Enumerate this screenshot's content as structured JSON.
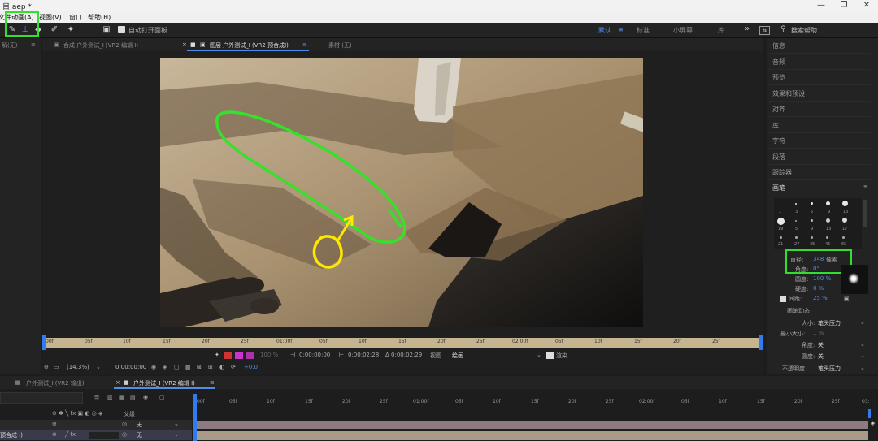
{
  "titlebar": {
    "title": "目.aep *",
    "minimize": "—",
    "maximize": "❐",
    "close": "✕"
  },
  "menubar": {
    "items": [
      "文件",
      "动画(A)",
      "视图(V)",
      "窗口",
      "帮助(H)"
    ]
  },
  "toolbar": {
    "auto_open_label": "自动打开面板",
    "workspaces": [
      "默认",
      "标准",
      "小屏幕",
      "库"
    ],
    "search_placeholder": "搜索帮助",
    "more": "»"
  },
  "left_panel": {
    "header": "解(无)"
  },
  "viewer": {
    "tabs": [
      "合成 户外测试_I (VR2 编辑 I)",
      "图层 户外测试_I (VR2 预合成I)",
      "素材 (无)"
    ],
    "ruler_ticks": [
      "00f",
      "05f",
      "10f",
      "15f",
      "20f",
      "25f",
      "01:00f",
      "05f",
      "10f",
      "15f",
      "20f",
      "25f",
      "02:00f",
      "05f",
      "10f",
      "15f",
      "20f",
      "25f"
    ],
    "timecode_start": "0:00:00:00",
    "timecode_current": "0:00:00:00",
    "timecode_end": "0:00:02:28",
    "timecode_duration": "Δ 0:00:02:29",
    "view_label": "视图",
    "view_value": "绘画",
    "render_label": "渲染",
    "zoom": "(14.3%)",
    "footer_time": "0:00:00:00",
    "offset": "+0.0"
  },
  "right_panel": {
    "items": [
      "信息",
      "音频",
      "预览",
      "效果和预设",
      "对齐",
      "库",
      "字符",
      "段落",
      "跟踪器"
    ],
    "brush_title": "画笔",
    "brush_sizes": [
      "1",
      "3",
      "5",
      "9",
      "13",
      "19",
      "5",
      "9",
      "13",
      "17",
      "21",
      "27",
      "35",
      "45",
      "65"
    ],
    "diameter_label": "直径:",
    "diameter_value": "348",
    "diameter_unit": "像素",
    "angle_label": "角度:",
    "angle_value": "0°",
    "roundness_label": "圆度:",
    "roundness_value": "100 %",
    "hardness_label": "硬度:",
    "hardness_value": "0 %",
    "spacing_label": "间距:",
    "spacing_value": "25 %",
    "dynamics_title": "画笔动态",
    "size_label": "大小:",
    "size_value": "笔头压力",
    "min_size_label": "最小大小:",
    "min_size_value": "1 %",
    "angle2_label": "角度:",
    "angle2_value": "关",
    "roundness2_label": "圆度:",
    "roundness2_value": "关",
    "opacity_label": "不透明度:",
    "opacity_value": "笔头压力"
  },
  "timeline": {
    "tabs": [
      "户外测试_I (VR2 输出)",
      "户外测试_I (VR2 编辑 I)"
    ],
    "parent_header": "父级",
    "ruler_ticks": [
      "00f",
      "05f",
      "10f",
      "15f",
      "20f",
      "25f",
      "01:00f",
      "05f",
      "10f",
      "15f",
      "20f",
      "25f",
      "02:00f",
      "05f",
      "10f",
      "15f",
      "20f",
      "25f",
      "03:"
    ],
    "rows": [
      {
        "parent": "无"
      },
      {
        "name": "预合成 I)",
        "parent": "无"
      }
    ]
  },
  "colors": {
    "highlight": "#2fe02f",
    "accent": "#4f8fe8",
    "annotation_green": "#37e12b",
    "annotation_yellow": "#ffe800"
  }
}
